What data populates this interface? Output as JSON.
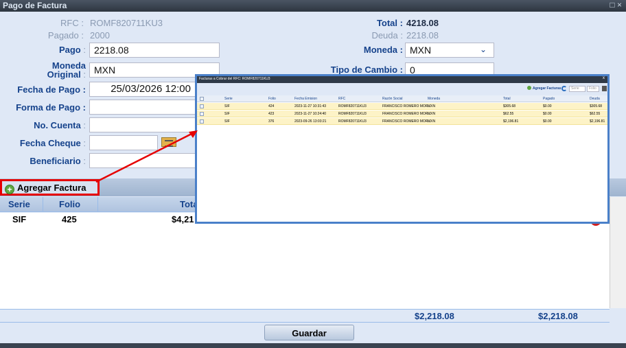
{
  "window": {
    "title": "Pago de Factura",
    "max_glyph": "□ ×"
  },
  "form": {
    "rfc_label": "RFC",
    "rfc_value": "ROMF820711KU3",
    "pagado_label": "Pagado",
    "pagado_value": "2000",
    "pago_label": "Pago",
    "pago_value": "2218.08",
    "moneda_original_label_1": "Moneda",
    "moneda_original_label_2": "Original",
    "moneda_original_value": "MXN",
    "fecha_pago_label": "Fecha de Pago",
    "fecha_pago_value": "25/03/2026 12:00",
    "forma_pago_label": "Forma de Pago",
    "no_cuenta_label": "No. Cuenta",
    "fecha_cheque_label": "Fecha Cheque",
    "beneficiario_label": "Beneficiario",
    "total_label": "Total",
    "total_value": "4218.08",
    "deuda_label": "Deuda",
    "deuda_value": "2218.08",
    "moneda_label": "Moneda",
    "moneda_value": "MXN",
    "tipo_cambio_label": "Tipo de Cambio",
    "tipo_cambio_value": "0",
    "sep": ":"
  },
  "toolbar": {
    "agregar_label": "Agregar Factura"
  },
  "grid": {
    "columns": [
      "Serie",
      "Folio",
      "Tota"
    ],
    "row": {
      "serie": "SIF",
      "folio": "425",
      "total": "$4,21"
    },
    "totals": [
      "$2,218.08",
      "$2,218.08"
    ]
  },
  "buttons": {
    "guardar": "Guardar"
  },
  "popup": {
    "title": "Facturas a Cobrar del RFC: ROMF820711KU3",
    "close": "x",
    "agregar_label": "Agregar Facturas",
    "serie_placeholder": "Serie",
    "folio_placeholder": "Folio",
    "columns": [
      "Serie",
      "Folio",
      "Fecha Emision",
      "RFC",
      "Razón Social",
      "Moneda",
      "Total",
      "Pagado",
      "Deuda"
    ],
    "rows": [
      [
        "SIF",
        "424",
        "2023-11-27 10:31:43",
        "ROMF820711KU3",
        "FRANCISCO ROMERO MOR...",
        "MXN",
        "$305.68",
        "$0.00",
        "$305.68"
      ],
      [
        "SIF",
        "423",
        "2023-11-27 10:24:40",
        "ROMF820711KU3",
        "FRANCISCO ROMERO MOR...",
        "MXN",
        "$62.55",
        "$0.00",
        "$62.55"
      ],
      [
        "SIF",
        "376",
        "2023-09-26 13:03:21",
        "ROMF820711KU3",
        "FRANCISCO ROMERO MOR...",
        "MXN",
        "$2,196.81",
        "$0.00",
        "$2,196.81"
      ]
    ]
  },
  "colors": {
    "accent": "#15428b",
    "highlight": "#e60000",
    "row_highlight": "#fdf3c7"
  }
}
